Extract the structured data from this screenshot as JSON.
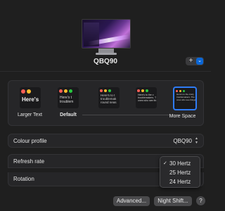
{
  "display": {
    "name": "QBQ90"
  },
  "toolbar": {
    "add_symbol": "+",
    "dropdown_symbol": "⌄"
  },
  "resolution": {
    "options": [
      {
        "label": "Larger Text",
        "preview_text": "Here's",
        "selected": false
      },
      {
        "label": "Default",
        "preview_lines": [
          "Here's t",
          "troublem"
        ],
        "selected": false
      },
      {
        "label": "",
        "preview_lines": [
          "Here's to t",
          "troublemak",
          "round neas"
        ],
        "selected": false
      },
      {
        "label": "",
        "preview_lines": [
          "Here's to the c",
          "troublemakers. T",
          "ones who see thi"
        ],
        "selected": false
      },
      {
        "label": "More Space",
        "preview_lines": [
          "Here's to the crazy",
          "troublemakers. The",
          "ones who see things"
        ],
        "selected": true
      }
    ]
  },
  "settings": {
    "colour_profile": {
      "label": "Colour profile",
      "value": "QBQ90"
    },
    "refresh_rate": {
      "label": "Refresh rate"
    },
    "rotation": {
      "label": "Rotation"
    }
  },
  "refresh_menu": {
    "items": [
      {
        "label": "30 Hertz",
        "checked": true
      },
      {
        "label": "25 Hertz",
        "checked": false
      },
      {
        "label": "24 Hertz",
        "checked": false
      }
    ],
    "check_symbol": "✓"
  },
  "buttons": {
    "advanced": "Advanced...",
    "night_shift": "Night Shift...",
    "help": "?"
  },
  "colors": {
    "accent": "#2f7cf6",
    "dot_red": "#ff5f57",
    "dot_yellow": "#febc2e",
    "dot_green": "#28c840"
  }
}
